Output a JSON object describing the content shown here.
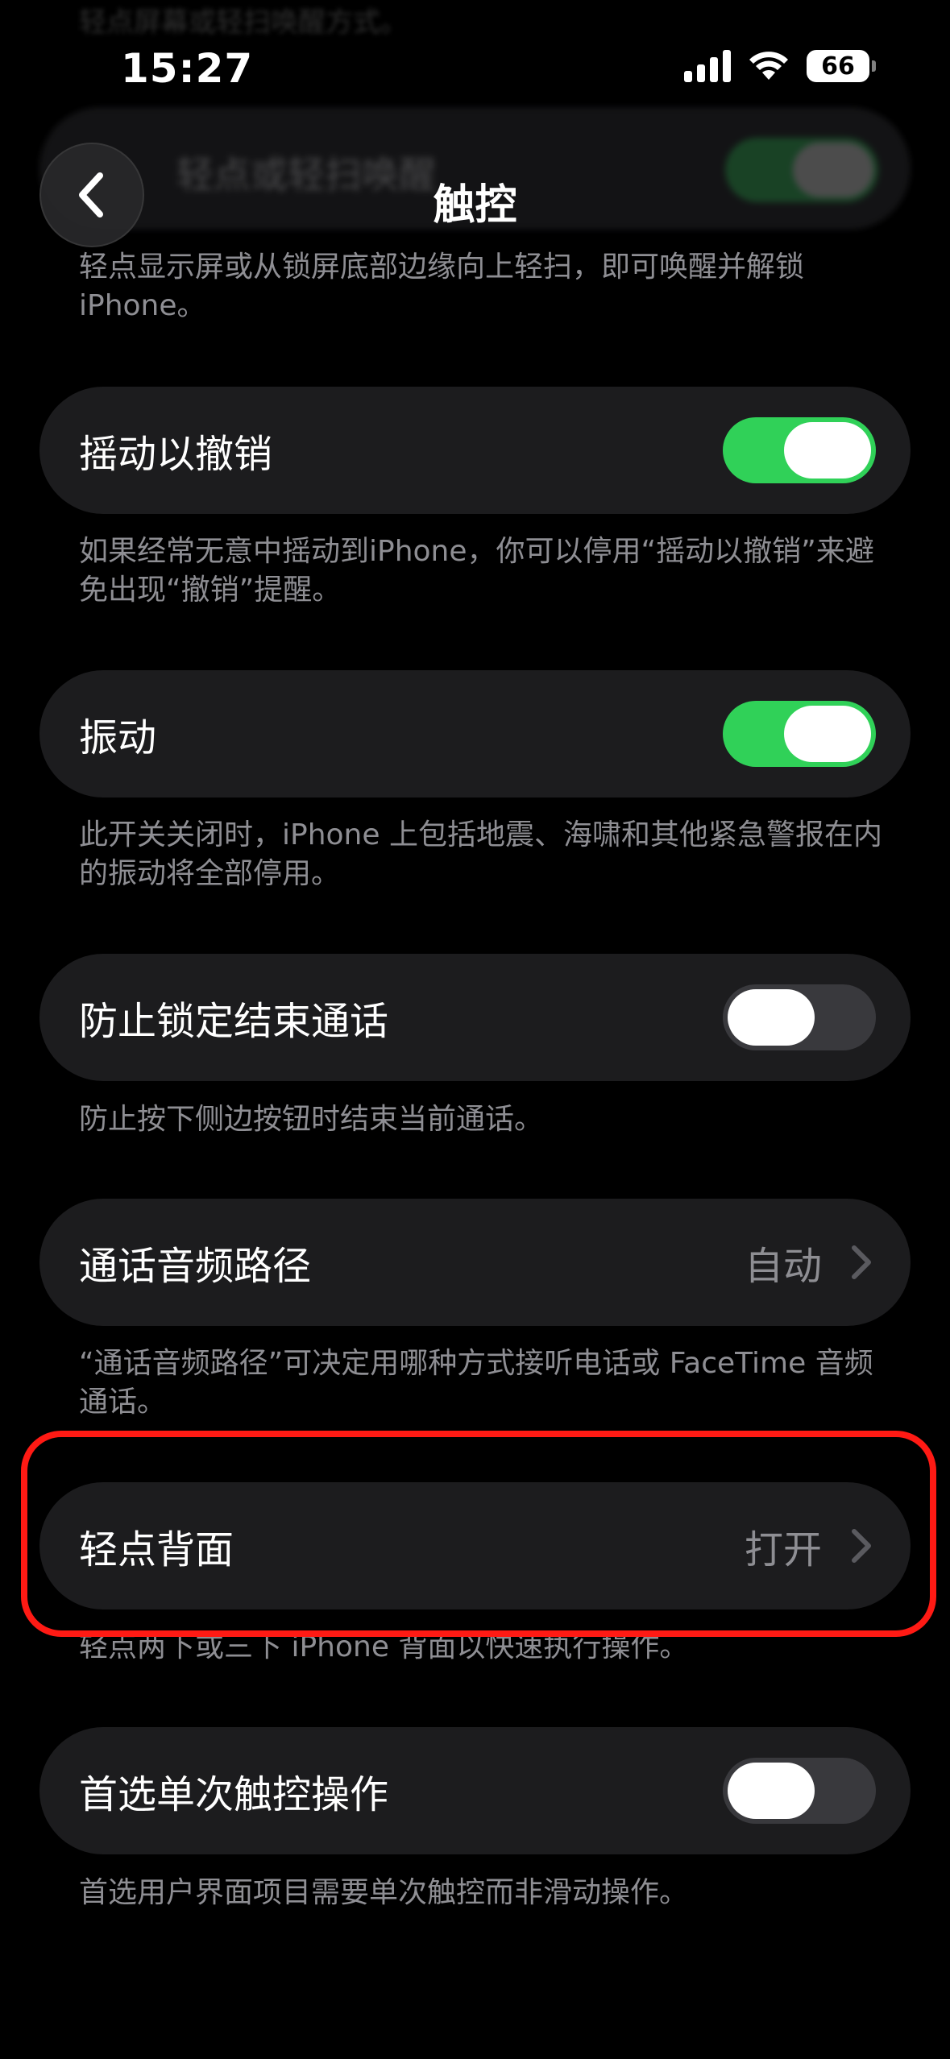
{
  "status_bar": {
    "time": "15:27",
    "battery": "66"
  },
  "nav": {
    "title": "触控",
    "back_icon": "chevron-left-icon"
  },
  "ghost": {
    "top_text": "轻点屏幕或轻扫唤醒方式。",
    "card_label": "轻点或轻扫唤醒"
  },
  "sections": {
    "wake_desc": "轻点显示屏或从锁屏底部边缘向上轻扫，即可唤醒并解锁 iPhone。",
    "shake_undo": {
      "label": "摇动以撤销",
      "enabled": true,
      "desc": "如果经常无意中摇动到iPhone，你可以停用“摇动以撤销”来避免出现“撤销”提醒。"
    },
    "vibration": {
      "label": "振动",
      "enabled": true,
      "desc": "此开关关闭时，iPhone 上包括地震、海啸和其他紧急警报在内的振动将全部停用。"
    },
    "prevent_lock": {
      "label": "防止锁定结束通话",
      "enabled": false,
      "desc": "防止按下侧边按钮时结束当前通话。"
    },
    "call_audio": {
      "label": "通话音频路径",
      "value": "自动",
      "desc": "“通话音频路径”可决定用哪种方式接听电话或 FaceTime 音频通话。"
    },
    "back_tap": {
      "label": "轻点背面",
      "value": "打开",
      "desc": "轻点两下或三下 iPhone 背面以快速执行操作。"
    },
    "single_touch": {
      "label": "首选单次触控操作",
      "enabled": false,
      "desc": "首选用户界面项目需要单次触控而非滑动操作。"
    }
  },
  "colors": {
    "background": "#000000",
    "card": "#1c1c1e",
    "toggle_on": "#30d158",
    "toggle_off": "#39393d",
    "secondary_text": "#8e8e93",
    "highlight": "#ff1a14"
  }
}
